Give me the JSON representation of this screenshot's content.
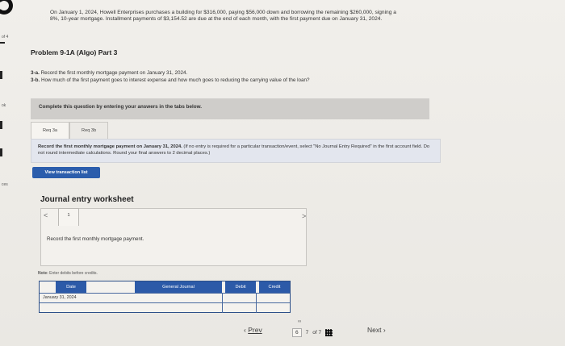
{
  "sidebar": {
    "counter": "of 4",
    "labels": [
      "ok",
      "ces"
    ]
  },
  "intro_text": "On January 1, 2024, Howell Enterprises purchases a building for $316,000, paying $56,000 down and borrowing the remaining $260,000, signing a 8%, 10-year mortgage. Installment payments of $3,154.52 are due at the end of each month, with the first payment due on January 31, 2024.",
  "problem_title": "Problem 9-1A (Algo) Part 3",
  "requirements": [
    {
      "label": "3-a.",
      "text": "Record the first monthly mortgage payment on January 31, 2024."
    },
    {
      "label": "3-b.",
      "text": "How much of the first payment goes to interest expense and how much goes to reducing the carrying value of the loan?"
    }
  ],
  "instruction": "Complete this question by entering your answers in the tabs below.",
  "tabs": [
    {
      "label": "Req 3a",
      "active": true
    },
    {
      "label": "Req 3b",
      "active": false
    }
  ],
  "req_panel": {
    "bold": "Record the first monthly mortgage payment on January 31, 2024.",
    "rest": " (If no entry is required for a particular transaction/event, select \"No Journal Entry Required\" in the first account field. Do not round intermediate calculations. Round your final answers to 2 decimal places.)"
  },
  "view_button": "View transaction list",
  "worksheet": {
    "title": "Journal entry worksheet",
    "page": "1",
    "prev_arrow": "<",
    "next_arrow": ">",
    "description": "Record the first monthly mortgage payment."
  },
  "note": {
    "label": "Note:",
    "text": " Enter debits before credits."
  },
  "journal": {
    "headers": {
      "date": "Date",
      "account": "General Journal",
      "debit": "Debit",
      "credit": "Credit"
    },
    "date_value": "January 31, 2024"
  },
  "bottom_nav": {
    "prev": "Prev",
    "pages": [
      "6",
      "7"
    ],
    "of_label": "of 7",
    "next": "Next"
  }
}
